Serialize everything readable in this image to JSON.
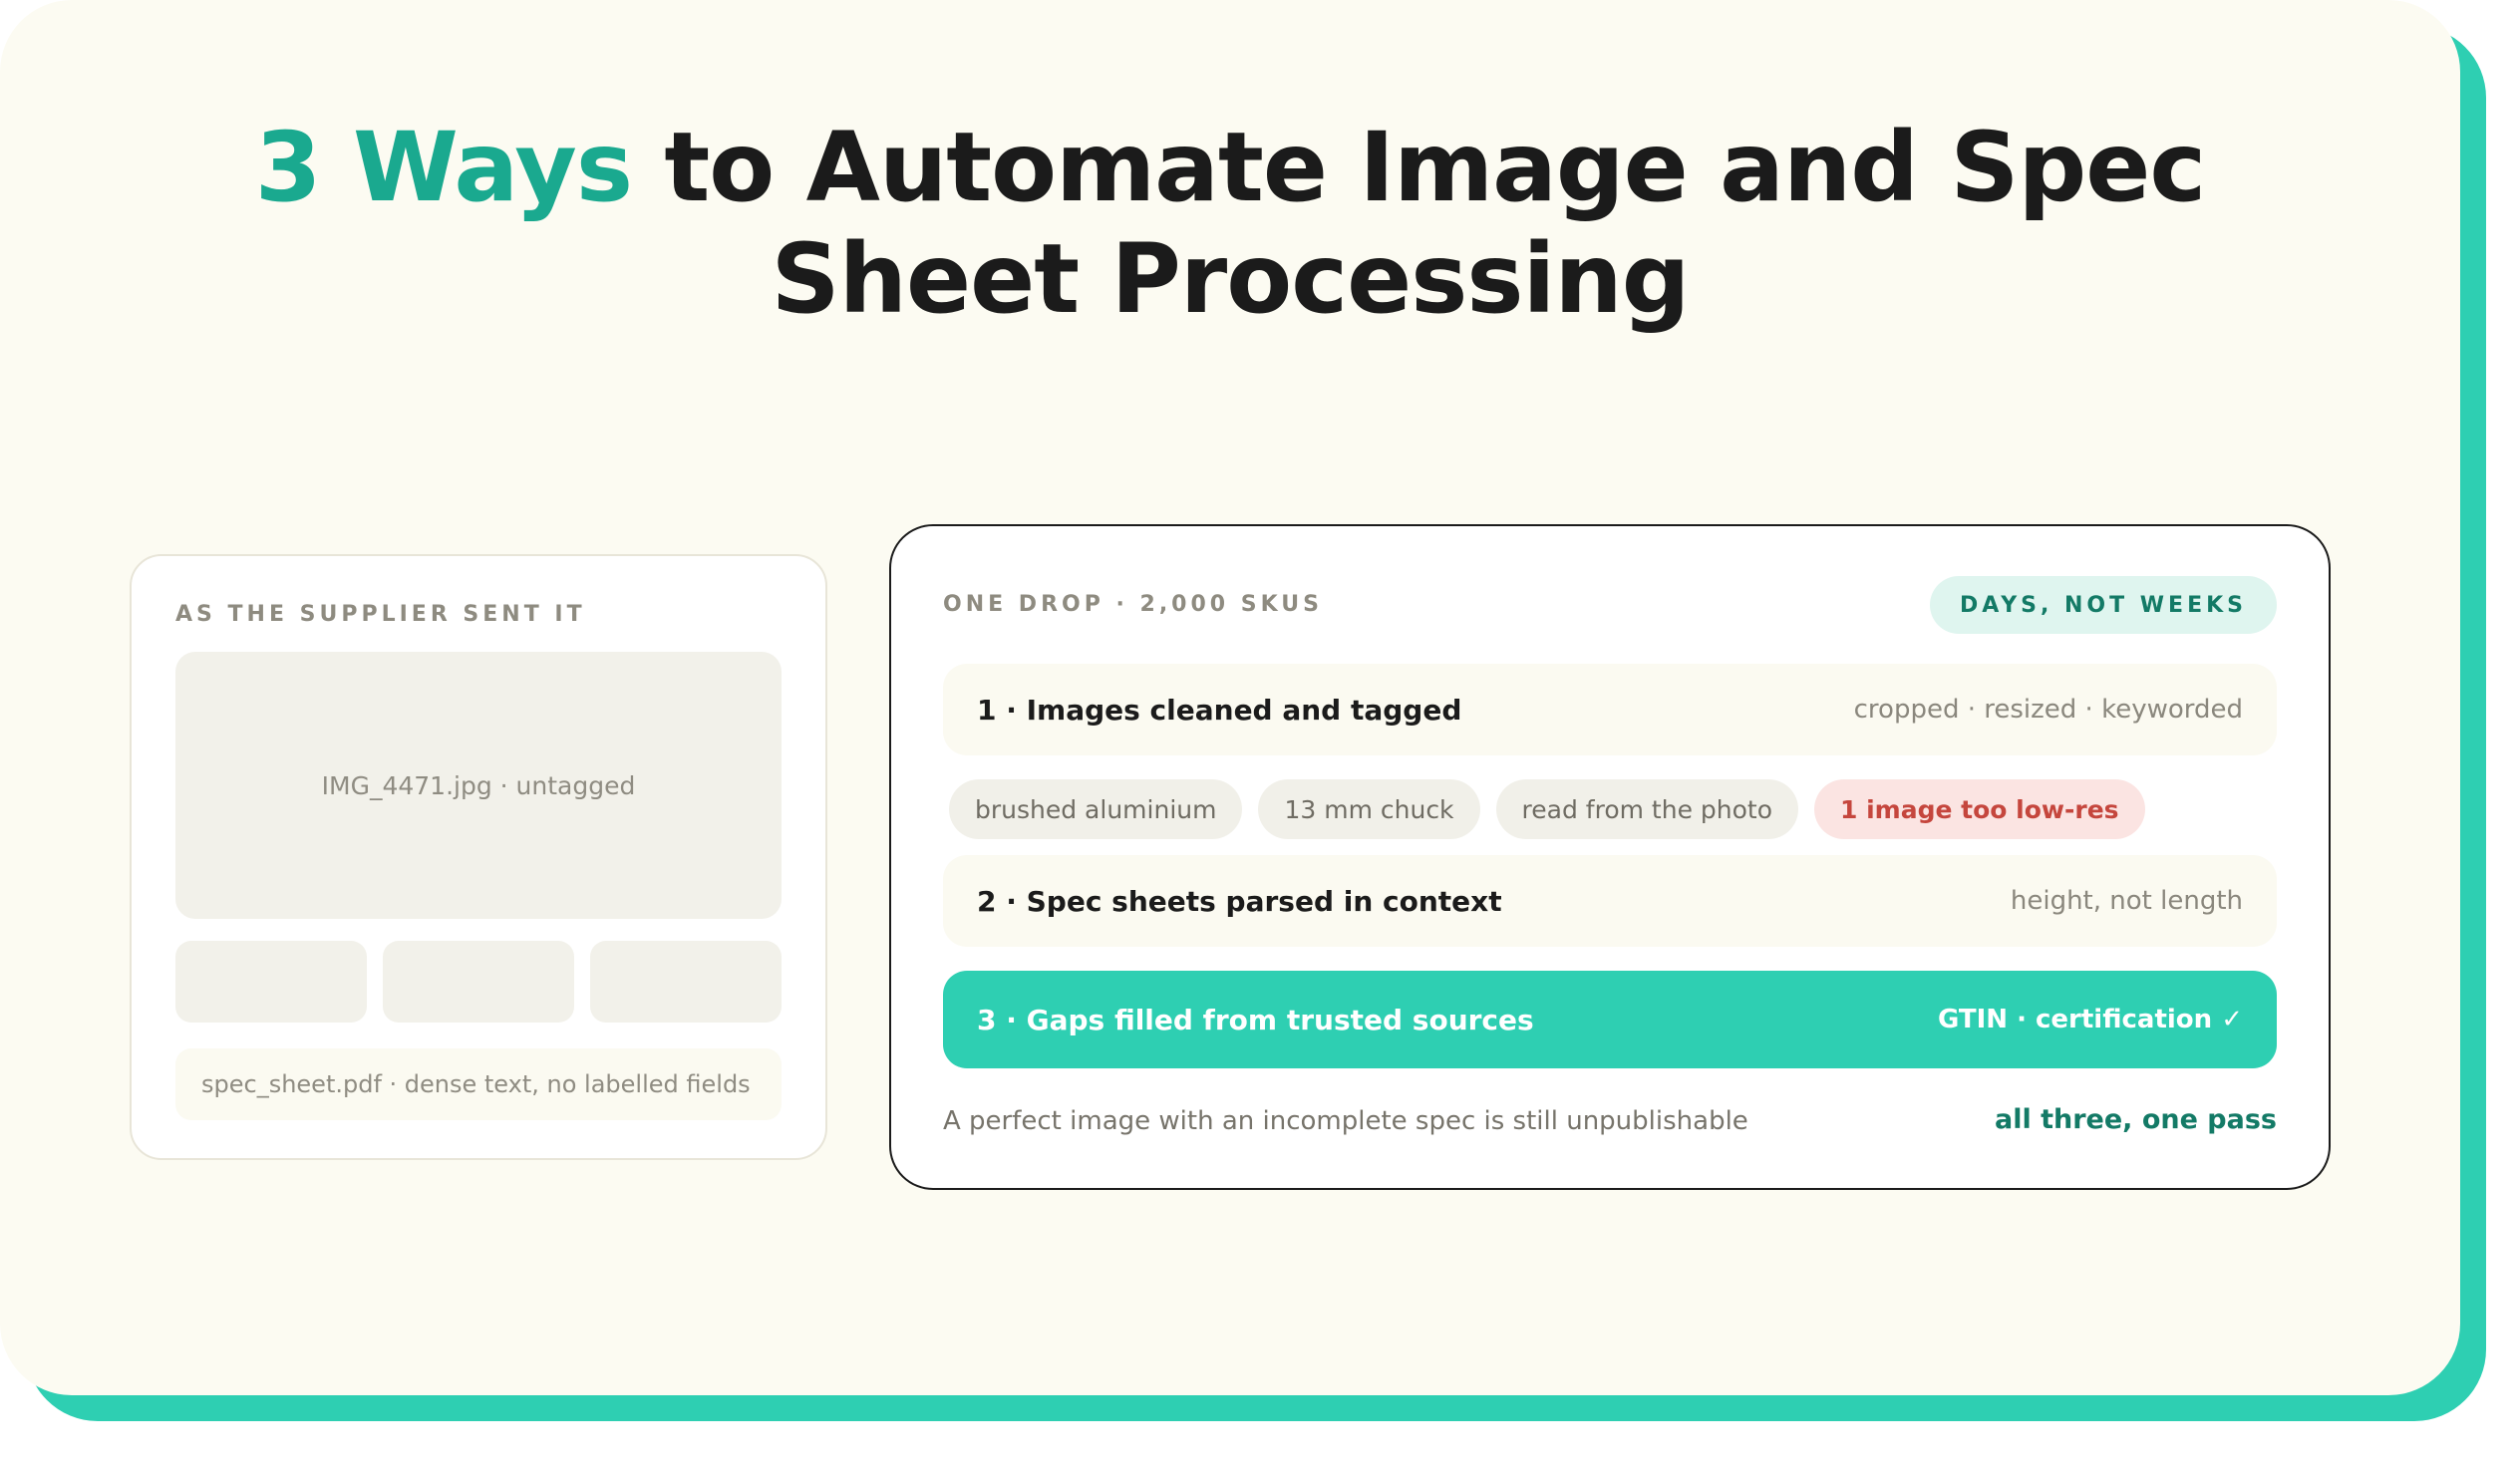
{
  "headline": {
    "accent": "3 Ways",
    "rest": "to Automate Image and Spec Sheet Processing"
  },
  "supplier_panel": {
    "label": "AS THE SUPPLIER SENT IT",
    "main_image_caption": "IMG_4471.jpg · untagged",
    "spec_sheet_caption": "spec_sheet.pdf · dense text, no labelled fields"
  },
  "pipeline_panel": {
    "label": "ONE DROP · 2,000 SKUS",
    "badge": "DAYS, NOT WEEKS",
    "steps": [
      {
        "label": "1 · Images cleaned and tagged",
        "note": "cropped · resized · keyworded"
      },
      {
        "label": "2 · Spec sheets parsed in context",
        "note": "height, not length"
      },
      {
        "label": "3 · Gaps filled from trusted sources",
        "note": "GTIN · certification ✓"
      }
    ],
    "tags": [
      {
        "text": "brushed aluminium"
      },
      {
        "text": "13 mm chuck"
      },
      {
        "text": "read from the photo"
      },
      {
        "text": "1 image too low-res"
      }
    ],
    "footer_text": "A perfect image with an incomplete spec is still unpublishable",
    "footer_accent": "all three, one pass"
  },
  "colors": {
    "accent": "#1aa98f",
    "highlight": "#2ecfb2",
    "card_background": "#fcfbf2",
    "warning": "#c5463d"
  }
}
